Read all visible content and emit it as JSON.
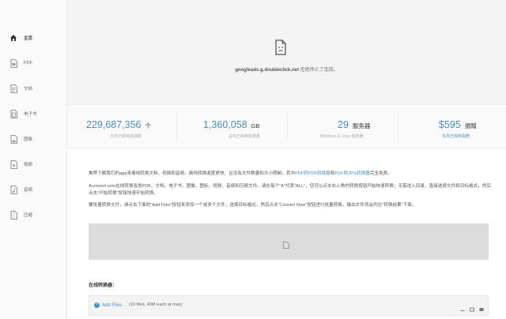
{
  "sidebar": {
    "items": [
      {
        "label": "主页",
        "icon": "home-icon"
      },
      {
        "label": "PDF",
        "icon": "pdf-file-icon"
      },
      {
        "label": "文档",
        "icon": "document-file-icon"
      },
      {
        "label": "电子书",
        "icon": "ebook-file-icon"
      },
      {
        "label": "图像",
        "icon": "image-file-icon"
      },
      {
        "label": "视频",
        "icon": "video-file-icon"
      },
      {
        "label": "音频",
        "icon": "audio-file-icon"
      },
      {
        "label": "压缩",
        "icon": "archive-file-icon"
      }
    ]
  },
  "banner": {
    "host": "googleads.g.doubleclick.net",
    "message": "拒绝停止了连接。"
  },
  "stats": [
    {
      "value": "229,687,356",
      "unit": "个",
      "caption": "文件已转换完成数"
    },
    {
      "value": "1,360,058",
      "unit": "GB",
      "caption": "总共已转换数据量"
    },
    {
      "value": "29",
      "unit": "服务器",
      "caption": "Windows & Linux 服务器"
    },
    {
      "value": "$595",
      "unit": "捐赠",
      "caption": "本月已收到捐赠"
    }
  ],
  "content": {
    "p1_text": "推荐下载我们的app来离线转换文档、视频和音频。离线转换速度更快，且没有文件数量和大小限制。其中",
    "p1_link1": "PDF转PDF转换器",
    "p1_mid": "和",
    "p1_link2": "PDF转JPG转换器",
    "p1_end": "完全免费。",
    "p2_text": "Aconvert.com在线转换各类PDF、文档、电子书、图像、图标、视频、音频和压缩文件。请在每个\"A\"代表\"ALL\"，您可以点击右上角的转换按钮开始快速转换；无需进入目录，直接选择文件和目标格式，然后点击\"开始转换\"按钮快速开始转换。",
    "p3_text": "要批量转换文件，请点击下面的\"Add Files\"按钮来添加一个或多个文件，选择目标格式，然后点击\"Convert Now\"按钮进行批量转换，输出文件将会列在\"转换结果\"下面。"
  },
  "converter": {
    "title": "在线转换器：",
    "add_label": "Add Files",
    "hint": "(10 files, 40M each at max)"
  }
}
